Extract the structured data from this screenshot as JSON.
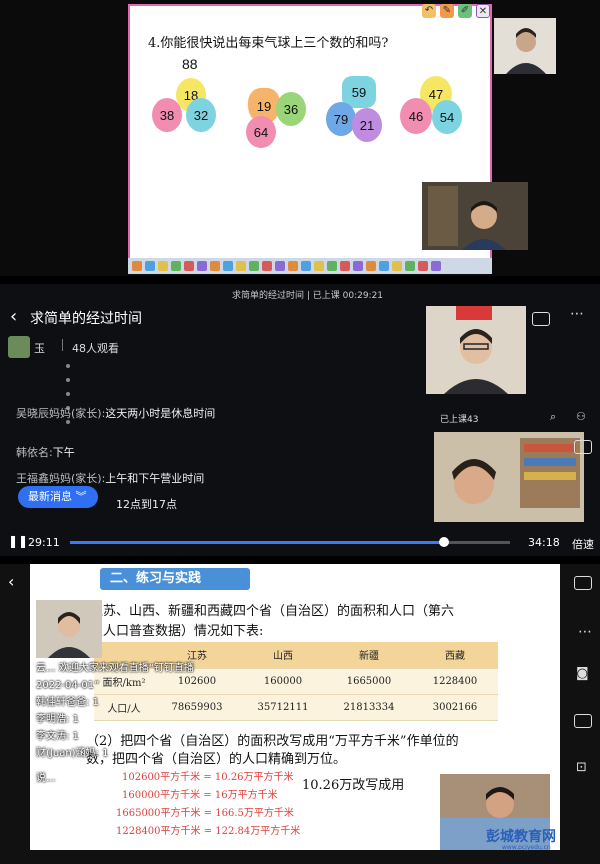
{
  "panel1": {
    "question": "4.你能很快说出每束气球上三个数的和吗?",
    "answer_shown": "88",
    "bunches": [
      {
        "numbers": [
          "18",
          "38",
          "32"
        ]
      },
      {
        "numbers": [
          "19",
          "36",
          "64"
        ]
      },
      {
        "numbers": [
          "59",
          "79",
          "21"
        ]
      },
      {
        "numbers": [
          "47",
          "46",
          "54"
        ]
      }
    ],
    "colors": {
      "slide_border": "#e26ab5",
      "balloon_yellow": "#f5e663",
      "balloon_pink": "#f28db2",
      "balloon_teal": "#7ed3e0",
      "balloon_green": "#9ad57a",
      "balloon_blue": "#6fa8e6"
    }
  },
  "panel2": {
    "topline": "求简单的经过时间 | 已上课 00:29:21",
    "title": "求简单的经过时间",
    "host_name": "玉",
    "viewers": "48人观看",
    "chat": [
      {
        "sender": "吴晓辰妈妈(家长):",
        "text": "这天两小时是休息时间"
      },
      {
        "sender": "韩依名:",
        "text": "下午"
      },
      {
        "sender": "王福鑫妈妈(家长):",
        "text": "上午和下午营业时间"
      },
      {
        "sender": "",
        "text": "12点到17点"
      }
    ],
    "latest_button": "最新消息",
    "attended": "已上课43",
    "time_current": "29:11",
    "time_total": "34:18",
    "speed": "倍速",
    "progress_fraction": 0.85,
    "accent": "#2f6ff2"
  },
  "panel3": {
    "brand": "钉钉直播",
    "section_title": "二、练习与实践",
    "problem_line1": "江苏、山西、新疆和西藏四个省（自治区）的面积和人口（第六",
    "problem_line2": "次人口普查数据）情况如下表:",
    "table": {
      "headers": [
        "",
        "江苏",
        "山西",
        "新疆",
        "西藏"
      ],
      "rows": [
        [
          "面积/km²",
          "102600",
          "160000",
          "1665000",
          "1228400"
        ],
        [
          "人口/人",
          "78659903",
          "35712111",
          "21813334",
          "3002166"
        ]
      ]
    },
    "task_line1": "（2）把四个省（自治区）的面积改写成用“万平方千米”作单位的",
    "task_line2": "数，把四个省（自治区）的人口精确到万位。",
    "calcs": [
      "102600平方千米 = 10.26万平方千米",
      "160000平方千米 = 16万平方千米",
      "1665000平方千米 = 166.5万平方千米",
      "1228400平方千米 = 122.84万平方千米"
    ],
    "note": "10.26万改写成用",
    "overlay_chat": [
      "云... 欢迎大家来观看直播“钉钉直播",
      "2022-04-01”",
      "韩佳轩爸爸: 1",
      "李明浩: 1",
      "李文涛: 1",
      "财(Juan)涵妈: 1",
      "说..."
    ],
    "watermark": "彭城教育网",
    "watermark_url": "www.pcjyedu.cn"
  }
}
